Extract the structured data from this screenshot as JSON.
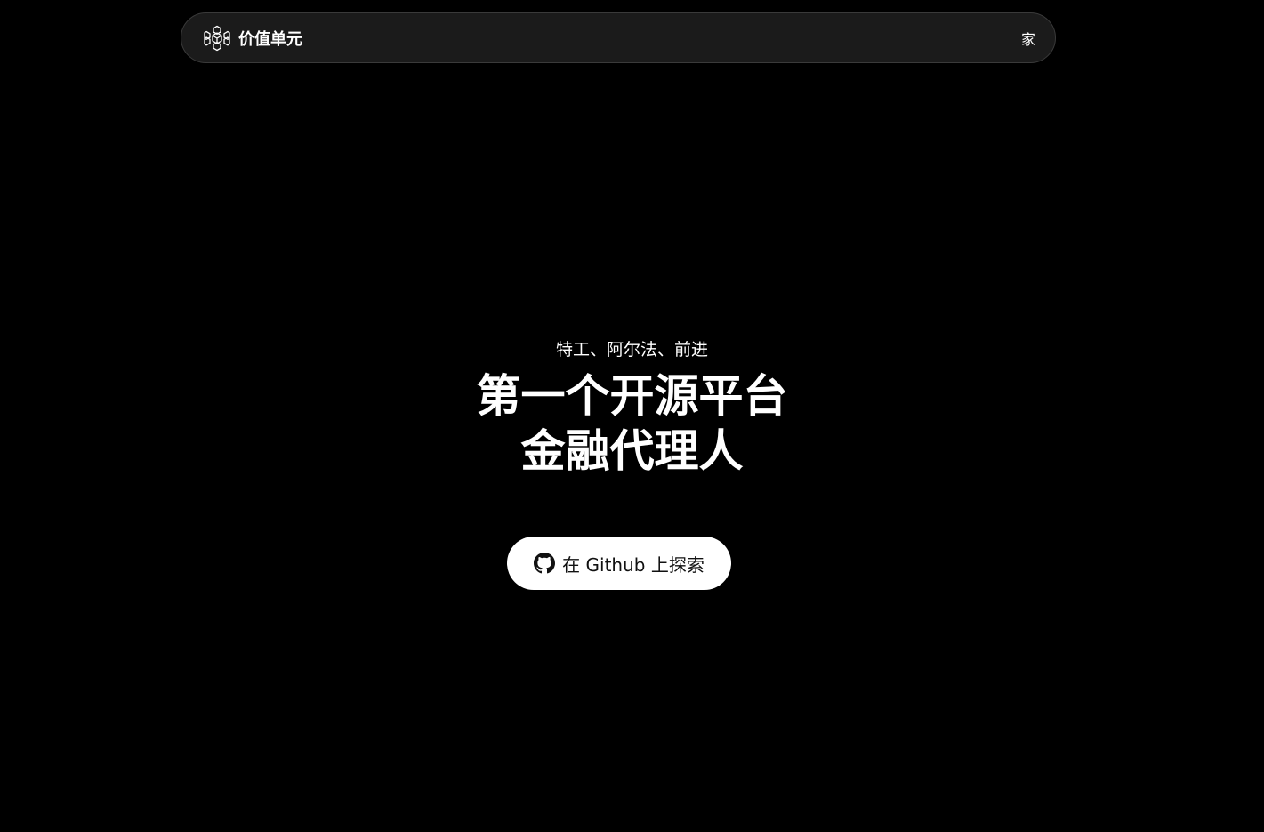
{
  "header": {
    "brand_name": "价值单元",
    "brand_icon": "cube-cluster-icon",
    "nav_home": "家"
  },
  "hero": {
    "subtitle": "特工、阿尔法、前进",
    "title_line1": "第一个开源平台",
    "title_line2": "金融代理人",
    "cta_label": "在 Github 上探索",
    "cta_icon": "github-icon"
  },
  "colors": {
    "background": "#000000",
    "navbar_bg": "#1b1b1b",
    "navbar_border": "#3a3a3a",
    "text": "#ffffff",
    "cta_bg": "#ffffff",
    "cta_text": "#111111"
  }
}
